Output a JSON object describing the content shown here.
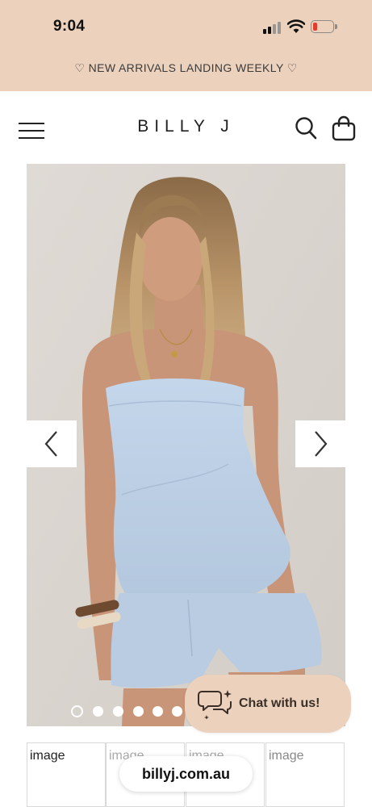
{
  "status_bar": {
    "time": "9:04"
  },
  "announcement": {
    "text": "♡ NEW ARRIVALS LANDING WEEKLY ♡"
  },
  "header": {
    "brand": "BILLY J"
  },
  "colors": {
    "peach": "#ecd2bd",
    "battery_low": "#e33b2e"
  },
  "icons": {
    "menu": "hamburger-menu-icon",
    "search": "search-icon",
    "bag": "shopping-bag-icon",
    "prev": "chevron-left-icon",
    "next": "chevron-right-icon",
    "chat": "chat-bubbles-sparkle-icon"
  },
  "product_gallery": {
    "image_alt": "Model wearing light blue strapless top and matching shorts",
    "slide_count": 6,
    "active_slide": 1
  },
  "chat": {
    "label": "Chat with us!"
  },
  "thumbnails": [
    {
      "label": "image"
    },
    {
      "label": "image"
    },
    {
      "label": "image"
    },
    {
      "label": "image"
    }
  ],
  "browser": {
    "url": "billyj.com.au"
  }
}
